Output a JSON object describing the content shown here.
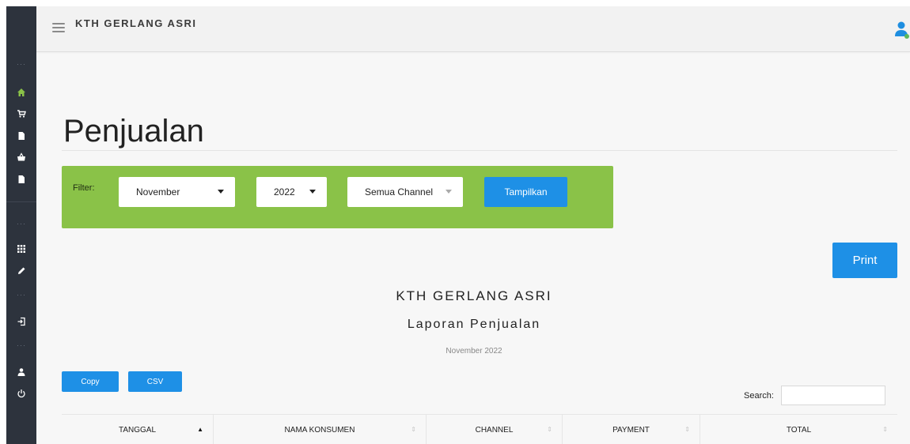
{
  "app": {
    "brand": "KTH GERLANG ASRI"
  },
  "sidebar": {
    "items": [
      {
        "icon": "home-icon",
        "color": "#8ac248"
      },
      {
        "icon": "cart-icon",
        "color": "#ffffff"
      },
      {
        "icon": "file-icon",
        "color": "#ffffff"
      },
      {
        "icon": "basket-icon",
        "color": "#ffffff"
      },
      {
        "icon": "file-icon",
        "color": "#ffffff"
      },
      {
        "icon": "grid-icon",
        "color": "#ffffff"
      },
      {
        "icon": "pencil-icon",
        "color": "#ffffff"
      },
      {
        "icon": "sign-in-icon",
        "color": "#ffffff"
      },
      {
        "icon": "user-icon",
        "color": "#ffffff"
      },
      {
        "icon": "power-icon",
        "color": "#ffffff"
      }
    ]
  },
  "page": {
    "title": "Penjualan"
  },
  "filter": {
    "label": "Filter:",
    "month": "November",
    "year": "2022",
    "channel": "Semua Channel",
    "submit_label": "Tampilkan",
    "box_color": "#8ac248"
  },
  "actions": {
    "print_label": "Print",
    "copy_label": "Copy",
    "csv_label": "CSV",
    "accent_color": "#1e90e6"
  },
  "report": {
    "company": "KTH GERLANG ASRI",
    "title": "Laporan Penjualan",
    "period": "November 2022"
  },
  "search": {
    "label": "Search:",
    "value": ""
  },
  "table": {
    "columns": [
      {
        "label": "TANGGAL",
        "sort": "asc"
      },
      {
        "label": "NAMA KONSUMEN",
        "sort": "none"
      },
      {
        "label": "CHANNEL",
        "sort": "none"
      },
      {
        "label": "PAYMENT",
        "sort": "none"
      },
      {
        "label": "TOTAL",
        "sort": "none"
      }
    ]
  }
}
